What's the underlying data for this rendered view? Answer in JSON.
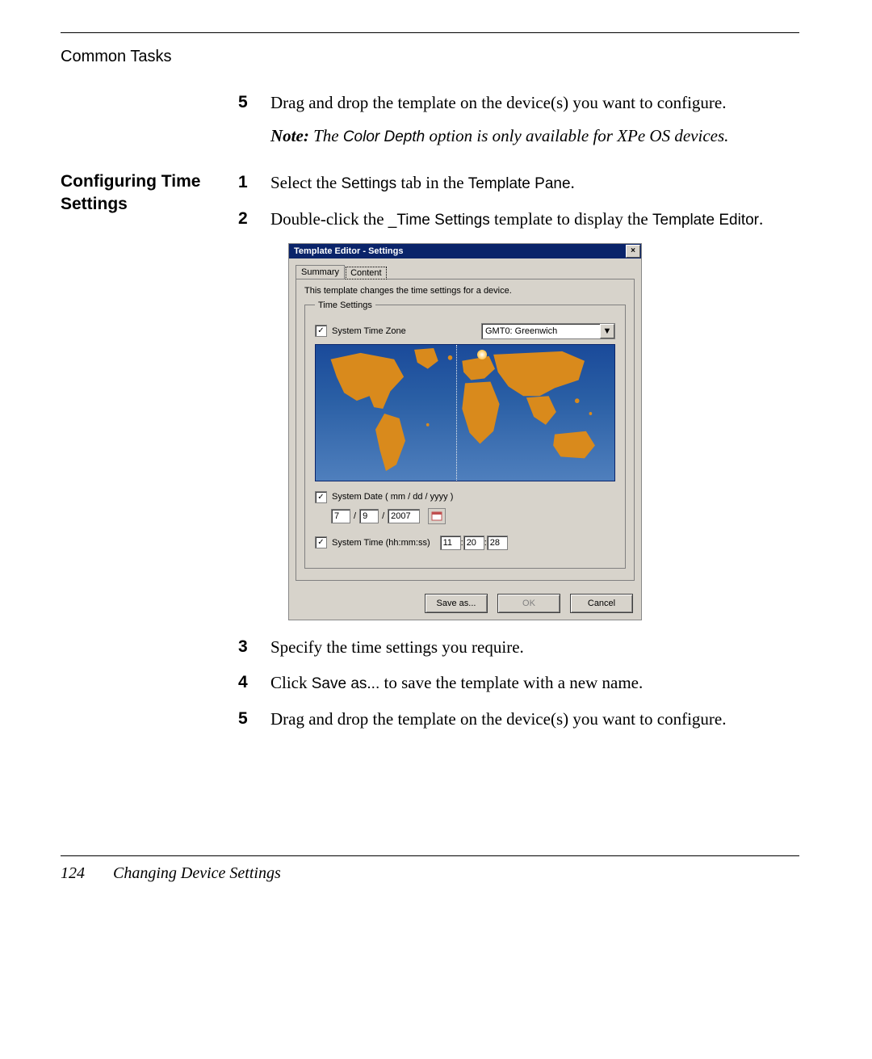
{
  "header": {
    "label": "Common Tasks"
  },
  "block_a": {
    "steps": [
      {
        "n": "5",
        "text": "Drag and drop the template on the device(s) you want to configure."
      }
    ],
    "note_prefix": "Note:",
    "note_body_a": " The ",
    "note_term": "Color Depth",
    "note_body_b": " option is only available for XPe OS devices."
  },
  "block_b": {
    "side_heading": "Configuring Time Settings",
    "steps_pre": [
      {
        "n": "1",
        "parts": {
          "a": "Select the ",
          "ui1": "Settings",
          "b": " tab in the ",
          "ui2": "Template Pane",
          "c": "."
        }
      },
      {
        "n": "2",
        "parts": {
          "a": "Double-click the ",
          "ui1": "_Time Settings",
          "b": " template to display the ",
          "ui2": "Template Editor",
          "c": "."
        }
      }
    ],
    "steps_post": [
      {
        "n": "3",
        "text": "Specify the time settings you require."
      },
      {
        "n": "4",
        "parts": {
          "a": "Click ",
          "ui1": "Save as...",
          "b": " to save the template with a new name."
        }
      },
      {
        "n": "5",
        "text": "Drag and drop the template on the device(s) you want to configure."
      }
    ]
  },
  "dialog": {
    "title": "Template Editor - Settings",
    "close_glyph": "×",
    "tabs": {
      "summary": "Summary",
      "content": "Content"
    },
    "description": "This template changes the time settings for a device.",
    "fieldset_legend": "Time Settings",
    "tz": {
      "check": "✓",
      "label": "System Time Zone",
      "value": "GMT0: Greenwich",
      "arrow": "▼"
    },
    "date": {
      "check": "✓",
      "label": "System Date ( mm / dd / yyyy )",
      "mm": "7",
      "dd": "9",
      "yyyy": "2007",
      "slash": "/"
    },
    "time": {
      "check": "✓",
      "label": "System Time (hh:mm:ss)",
      "hh": "11",
      "mm": "20",
      "ss": "28",
      "colon": ":"
    },
    "buttons": {
      "saveas": "Save as...",
      "ok": "OK",
      "cancel": "Cancel"
    }
  },
  "footer": {
    "page": "124",
    "title": "Changing Device Settings"
  }
}
